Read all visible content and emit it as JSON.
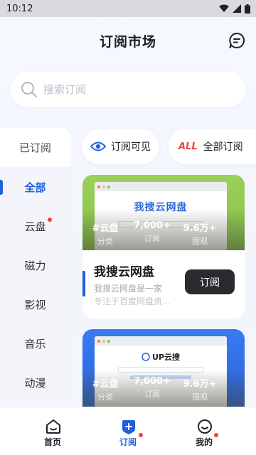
{
  "status": {
    "time": "10:12"
  },
  "header": {
    "title": "订阅市场"
  },
  "search": {
    "placeholder": "搜索订阅"
  },
  "sidebar": {
    "top_label": "已订阅",
    "items": [
      {
        "label": "全部",
        "active": true
      },
      {
        "label": "云盘",
        "badge": true
      },
      {
        "label": "磁力"
      },
      {
        "label": "影视"
      },
      {
        "label": "音乐"
      },
      {
        "label": "动漫"
      }
    ]
  },
  "filters": {
    "visible": {
      "label": "订阅可见"
    },
    "all": {
      "icon_text": "ALL",
      "label": "全部订阅"
    }
  },
  "cards": [
    {
      "category": "#云盘",
      "category_label": "分类",
      "subs": "7,000+",
      "subs_label": "订阅",
      "views": "9.6万+",
      "views_label": "围观",
      "shot_title": "我搜云网盘",
      "title": "我搜云网盘",
      "desc": "我搜云网盘是一家",
      "desc2": "专注于百度网盘资...",
      "button": "订阅",
      "color": "#8cc84b"
    },
    {
      "category": "#云盘",
      "category_label": "分类",
      "subs": "7,000+",
      "subs_label": "订阅",
      "views": "9.6万+",
      "views_label": "围观",
      "shot_title": "UP云搜",
      "color": "#2f6fe6"
    }
  ],
  "tabbar": {
    "home": "首页",
    "subscribe": "订阅",
    "mine": "我的"
  },
  "colors": {
    "accent": "#1f5fe0",
    "badge": "#f0413c",
    "button_dark": "#2a2b2e"
  }
}
